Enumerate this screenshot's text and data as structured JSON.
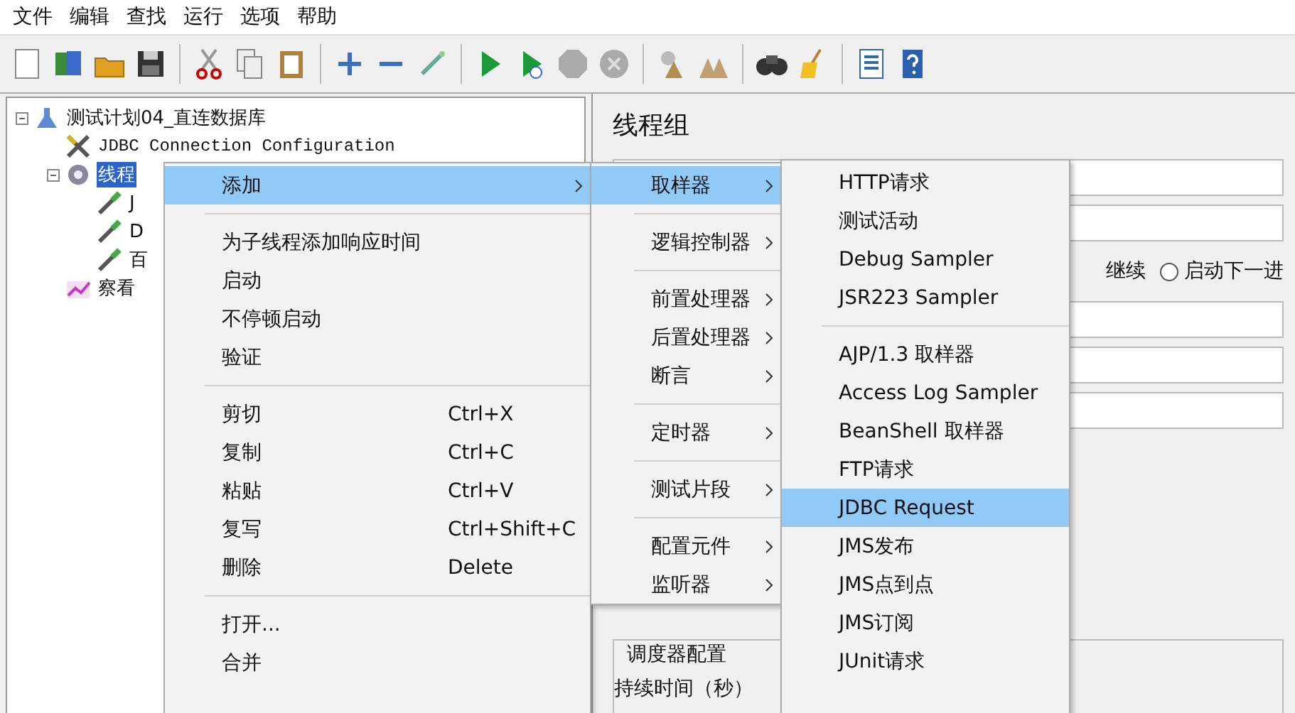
{
  "menu_bar": [
    "文件",
    "编辑",
    "查找",
    "运行",
    "选项",
    "帮助"
  ],
  "tree": [
    {
      "label": "测试计划04_直连数据库",
      "kind": "plan",
      "selected": false,
      "expanded": true,
      "children": [
        {
          "label": "JDBC Connection Configuration",
          "kind": "config",
          "selected": false
        },
        {
          "label": "线程",
          "kind": "group",
          "selected": true,
          "expanded": true,
          "children": [
            {
              "label": "J",
              "kind": "sampler",
              "selected": false
            },
            {
              "label": "D",
              "kind": "sampler",
              "selected": false
            },
            {
              "label": "百",
              "kind": "sampler",
              "selected": false
            }
          ]
        },
        {
          "label": "察看",
          "kind": "listener",
          "selected": false
        }
      ]
    }
  ],
  "panel": {
    "title": "线程组",
    "continue_label": "继续",
    "next_radio": {
      "label": "启动下一进",
      "selected": false
    },
    "scheduler": {
      "legend": "调度器配置",
      "duration_label": "持续时间（秒）"
    }
  },
  "context_menu": [
    {
      "kind": "item",
      "label": "添加",
      "submenu": true,
      "selected": true
    },
    {
      "kind": "separator"
    },
    {
      "kind": "item",
      "label": "为子线程添加响应时间",
      "selected": false
    },
    {
      "kind": "item",
      "label": "启动",
      "selected": false
    },
    {
      "kind": "item",
      "label": "不停顿启动",
      "selected": false
    },
    {
      "kind": "item",
      "label": "验证",
      "selected": false
    },
    {
      "kind": "separator"
    },
    {
      "kind": "item",
      "label": "剪切",
      "shortcut": "Ctrl+X",
      "selected": false
    },
    {
      "kind": "item",
      "label": "复制",
      "shortcut": "Ctrl+C",
      "selected": false
    },
    {
      "kind": "item",
      "label": "粘贴",
      "shortcut": "Ctrl+V",
      "selected": false
    },
    {
      "kind": "item",
      "label": "复写",
      "shortcut": "Ctrl+Shift+C",
      "selected": false
    },
    {
      "kind": "item",
      "label": "删除",
      "shortcut": "Delete",
      "selected": false
    },
    {
      "kind": "separator"
    },
    {
      "kind": "item",
      "label": "打开...",
      "selected": false
    },
    {
      "kind": "item",
      "label": "合并",
      "selected": false
    }
  ],
  "add_submenu": [
    {
      "kind": "item",
      "label": "取样器",
      "submenu": true,
      "selected": true
    },
    {
      "kind": "separator"
    },
    {
      "kind": "item",
      "label": "逻辑控制器",
      "submenu": true,
      "selected": false
    },
    {
      "kind": "separator"
    },
    {
      "kind": "item",
      "label": "前置处理器",
      "submenu": true,
      "selected": false
    },
    {
      "kind": "item",
      "label": "后置处理器",
      "submenu": true,
      "selected": false
    },
    {
      "kind": "item",
      "label": "断言",
      "submenu": true,
      "selected": false
    },
    {
      "kind": "separator"
    },
    {
      "kind": "item",
      "label": "定时器",
      "submenu": true,
      "selected": false
    },
    {
      "kind": "separator"
    },
    {
      "kind": "item",
      "label": "测试片段",
      "submenu": true,
      "selected": false
    },
    {
      "kind": "separator"
    },
    {
      "kind": "item",
      "label": "配置元件",
      "submenu": true,
      "selected": false
    },
    {
      "kind": "item",
      "label": "监听器",
      "submenu": true,
      "selected": false
    }
  ],
  "sampler_submenu": [
    {
      "kind": "item",
      "label": "HTTP请求",
      "selected": false
    },
    {
      "kind": "item",
      "label": "测试活动",
      "selected": false
    },
    {
      "kind": "item",
      "label": "Debug Sampler",
      "selected": false
    },
    {
      "kind": "item",
      "label": "JSR223 Sampler",
      "selected": false
    },
    {
      "kind": "separator"
    },
    {
      "kind": "item",
      "label": "AJP/1.3 取样器",
      "selected": false
    },
    {
      "kind": "item",
      "label": "Access Log Sampler",
      "selected": false
    },
    {
      "kind": "item",
      "label": "BeanShell 取样器",
      "selected": false
    },
    {
      "kind": "item",
      "label": "FTP请求",
      "selected": false
    },
    {
      "kind": "item",
      "label": "JDBC Request",
      "selected": true
    },
    {
      "kind": "item",
      "label": "JMS发布",
      "selected": false
    },
    {
      "kind": "item",
      "label": "JMS点到点",
      "selected": false
    },
    {
      "kind": "item",
      "label": "JMS订阅",
      "selected": false
    },
    {
      "kind": "item",
      "label": "JUnit请求",
      "selected": false
    }
  ]
}
